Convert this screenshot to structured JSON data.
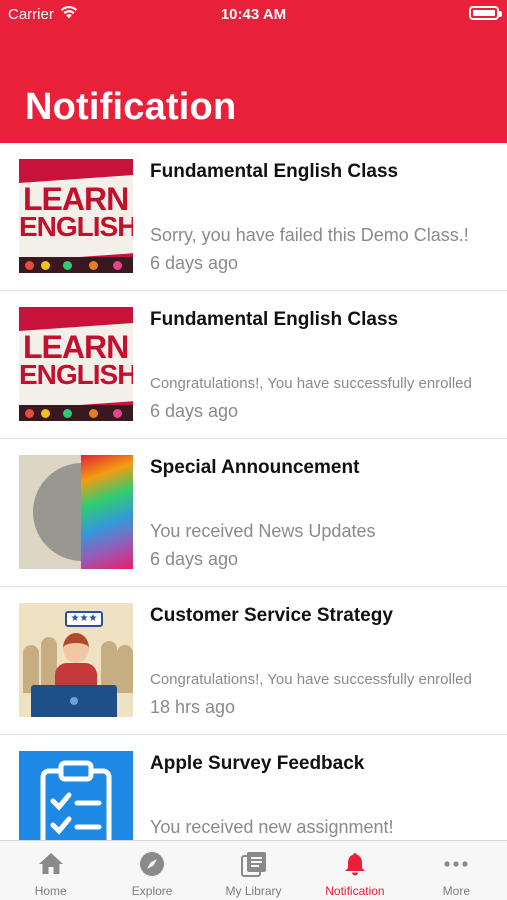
{
  "status_bar": {
    "carrier": "Carrier",
    "time": "10:43 AM"
  },
  "header": {
    "title": "Notification"
  },
  "notifications": [
    {
      "title": "Fundamental English Class",
      "message": "Sorry, you have failed this Demo Class.!",
      "time": "6 days ago",
      "thumbnail": "learn-english-image"
    },
    {
      "title": "Fundamental English Class",
      "message": "Congratulations!, You have successfully enrolled",
      "time": "6 days ago",
      "thumbnail": "learn-english-image"
    },
    {
      "title": "Special Announcement",
      "message": "You received News Updates",
      "time": "6 days ago",
      "thumbnail": "brain-art-image"
    },
    {
      "title": "Customer Service Strategy",
      "message": "Congratulations!, You have successfully enrolled",
      "time": "18 hrs ago",
      "thumbnail": "customer-service-image"
    },
    {
      "title": "Apple Survey Feedback",
      "message": "You received new assignment!",
      "time": "",
      "thumbnail": "clipboard-checklist-image"
    }
  ],
  "thumb_text": {
    "learn": "LEARN",
    "english": "ENGLISH",
    "stars": "★★★"
  },
  "tabbar": {
    "tabs": [
      {
        "label": "Home",
        "icon": "home-icon"
      },
      {
        "label": "Explore",
        "icon": "compass-icon"
      },
      {
        "label": "My Library",
        "icon": "library-icon"
      },
      {
        "label": "Notification",
        "icon": "bell-icon",
        "active": true
      },
      {
        "label": "More",
        "icon": "more-dots-icon"
      }
    ]
  },
  "colors": {
    "accent": "#e8203a",
    "tab_inactive": "#7d7d7d",
    "message_gray": "#8a8a8a"
  }
}
